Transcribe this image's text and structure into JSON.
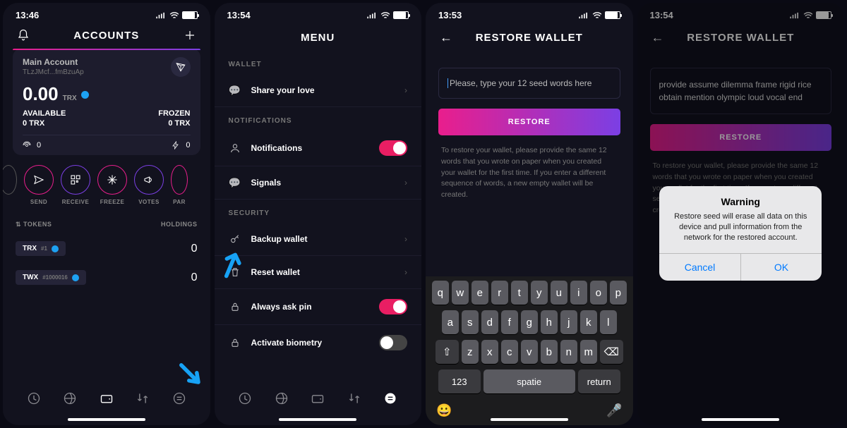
{
  "s1": {
    "time": "13:46",
    "title": "ACCOUNTS",
    "account_name": "Main Account",
    "account_addr": "TLzJMcf...fmBzuAp",
    "balance": "0.00",
    "currency": "TRX",
    "available_lbl": "AVAILABLE",
    "available_val": "0 TRX",
    "frozen_lbl": "FROZEN",
    "frozen_val": "0 TRX",
    "stat1": "0",
    "stat2": "0",
    "quick": [
      {
        "label": "SEND"
      },
      {
        "label": "RECEIVE"
      },
      {
        "label": "FREEZE"
      },
      {
        "label": "VOTES"
      },
      {
        "label": "PAR"
      }
    ],
    "tokens_lbl": "TOKENS",
    "holdings_lbl": "HOLDINGS",
    "rows": [
      {
        "sym": "TRX",
        "tag": "#1",
        "val": "0"
      },
      {
        "sym": "TWX",
        "tag": "#1000016",
        "val": "0"
      }
    ]
  },
  "s2": {
    "time": "13:54",
    "title": "MENU",
    "sect_wallet": "WALLET",
    "share": "Share your love",
    "sect_notif": "NOTIFICATIONS",
    "notif": "Notifications",
    "signals": "Signals",
    "sect_sec": "SECURITY",
    "backup": "Backup wallet",
    "reset": "Reset wallet",
    "askpin": "Always ask pin",
    "biometry": "Activate biometry"
  },
  "s3": {
    "time": "13:53",
    "title": "RESTORE WALLET",
    "placeholder": "Please, type your 12 seed words here",
    "btn": "RESTORE",
    "help": "To restore your wallet, please provide the same 12 words that you wrote on paper when you created your wallet for the first time. If you enter a different sequence of words, a new empty wallet will be created.",
    "kb_space": "spatie",
    "kb_return": "return",
    "kb_123": "123"
  },
  "s4": {
    "time": "13:54",
    "title": "RESTORE WALLET",
    "seed": "provide assume dilemma frame rigid rice obtain mention olympic loud vocal end",
    "btn": "RESTORE",
    "help": "To restore your wallet, please provide the same 12 words that you wrote on paper when you created your wallet for the first time. If you enter a different sequence of words, a new empty wallet will be created.",
    "dlg_title": "Warning",
    "dlg_msg": "Restore seed will erase all data on this device and pull information from the network for the restored account.",
    "dlg_cancel": "Cancel",
    "dlg_ok": "OK"
  }
}
